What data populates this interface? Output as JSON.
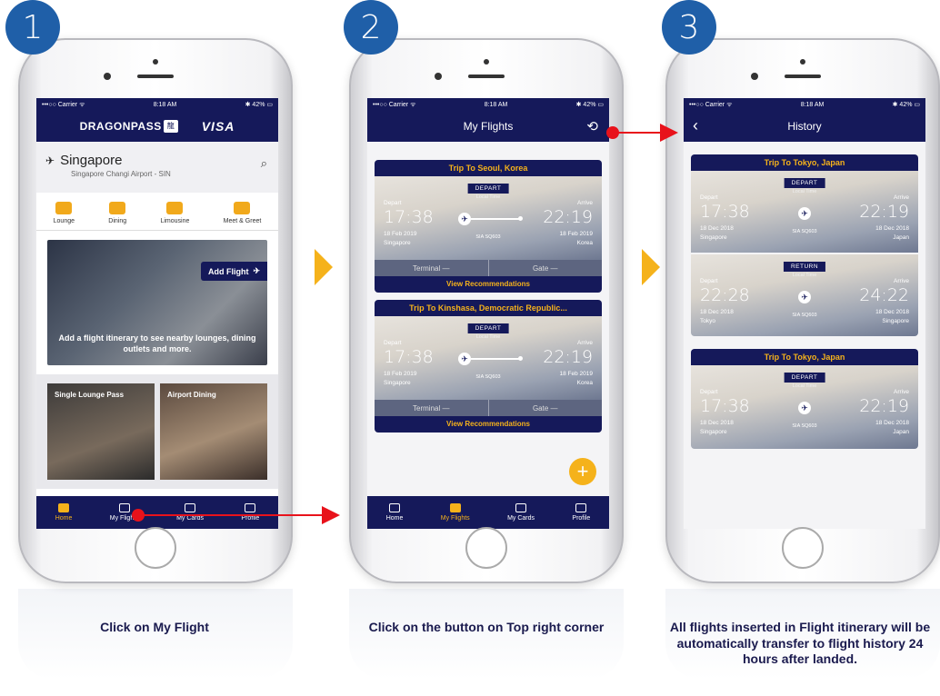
{
  "steps": [
    "1",
    "2",
    "3"
  ],
  "captions": {
    "step1": "Click on My Flight",
    "step2": "Click on the button on Top right corner",
    "step3": "All flights inserted in Flight itinerary will be automatically transfer to flight history 24 hours after landed."
  },
  "status": {
    "carrier": "•••○○ Carrier ᯤ",
    "time": "8:18 AM",
    "battery": "✱ 42% ▭"
  },
  "screen1": {
    "brand": "DRAGONPASS",
    "brand_mark": "龍",
    "card_brand": "VISA",
    "city": "Singapore",
    "airport": "Singapore Changi Airport - SIN",
    "services": [
      "Lounge",
      "Dining",
      "Limousine",
      "Meet & Greet"
    ],
    "add_flight": "Add Flight",
    "hero_caption": "Add a flight itinerary to see nearby lounges, dining outlets and more.",
    "tiles": [
      "Single Lounge Pass",
      "Airport Dining"
    ]
  },
  "tabs": [
    "Home",
    "My Flights",
    "My Cards",
    "Profile"
  ],
  "screen2": {
    "title": "My Flights",
    "flights": [
      {
        "trip": "Trip To Seoul, Korea",
        "tag": "DEPART",
        "local": "Local Time",
        "depart_lbl": "Depart",
        "arrive_lbl": "Arrive",
        "dep_time": "17:38",
        "arr_time": "22:19",
        "dep_date": "18 Feb 2019",
        "arr_date": "18 Feb 2019",
        "code": "SIA SQ603",
        "from": "Singapore",
        "to": "Korea",
        "terminal": "Terminal —",
        "gate": "Gate —",
        "rec": "View Recommendations"
      },
      {
        "trip": "Trip To Kinshasa, Democratic Republic...",
        "tag": "DEPART",
        "local": "Local Time",
        "depart_lbl": "Depart",
        "arrive_lbl": "Arrive",
        "dep_time": "17:38",
        "arr_time": "22:19",
        "dep_date": "18 Feb 2019",
        "arr_date": "18 Feb 2019",
        "code": "SIA SQ603",
        "from": "Singapore",
        "to": "Korea",
        "terminal": "Terminal —",
        "gate": "Gate —",
        "rec": "View Recommendations"
      }
    ]
  },
  "screen3": {
    "title": "History",
    "cards": [
      {
        "trip": "Trip To Tokyo, Japan",
        "legs": [
          {
            "tag": "DEPART",
            "local": "Local Time",
            "depart_lbl": "Depart",
            "arrive_lbl": "Arrive",
            "dep_time": "17:38",
            "arr_time": "22:19",
            "dep_date": "18 Dec 2018",
            "arr_date": "18 Dec 2018",
            "code": "SIA SQ603",
            "from": "Singapore",
            "to": "Japan"
          },
          {
            "tag": "RETURN",
            "local": "Local Time",
            "depart_lbl": "Depart",
            "arrive_lbl": "Arrive",
            "dep_time": "22:28",
            "arr_time": "24:22",
            "dep_date": "18 Dec 2018",
            "arr_date": "18 Dec 2018",
            "code": "SIA SQ603",
            "from": "Tokyo",
            "to": "Singapore"
          }
        ]
      },
      {
        "trip": "Trip To Tokyo, Japan",
        "legs": [
          {
            "tag": "DEPART",
            "local": "Local Time",
            "depart_lbl": "Depart",
            "arrive_lbl": "Arrive",
            "dep_time": "17:38",
            "arr_time": "22:19",
            "dep_date": "18 Dec 2018",
            "arr_date": "18 Dec 2018",
            "code": "SIA SQ603",
            "from": "Singapore",
            "to": "Japan"
          }
        ]
      }
    ]
  },
  "colors": {
    "navy": "#15195a",
    "gold": "#f5b21b",
    "badge": "#1f5fa8",
    "arrow": "#e8121b"
  }
}
